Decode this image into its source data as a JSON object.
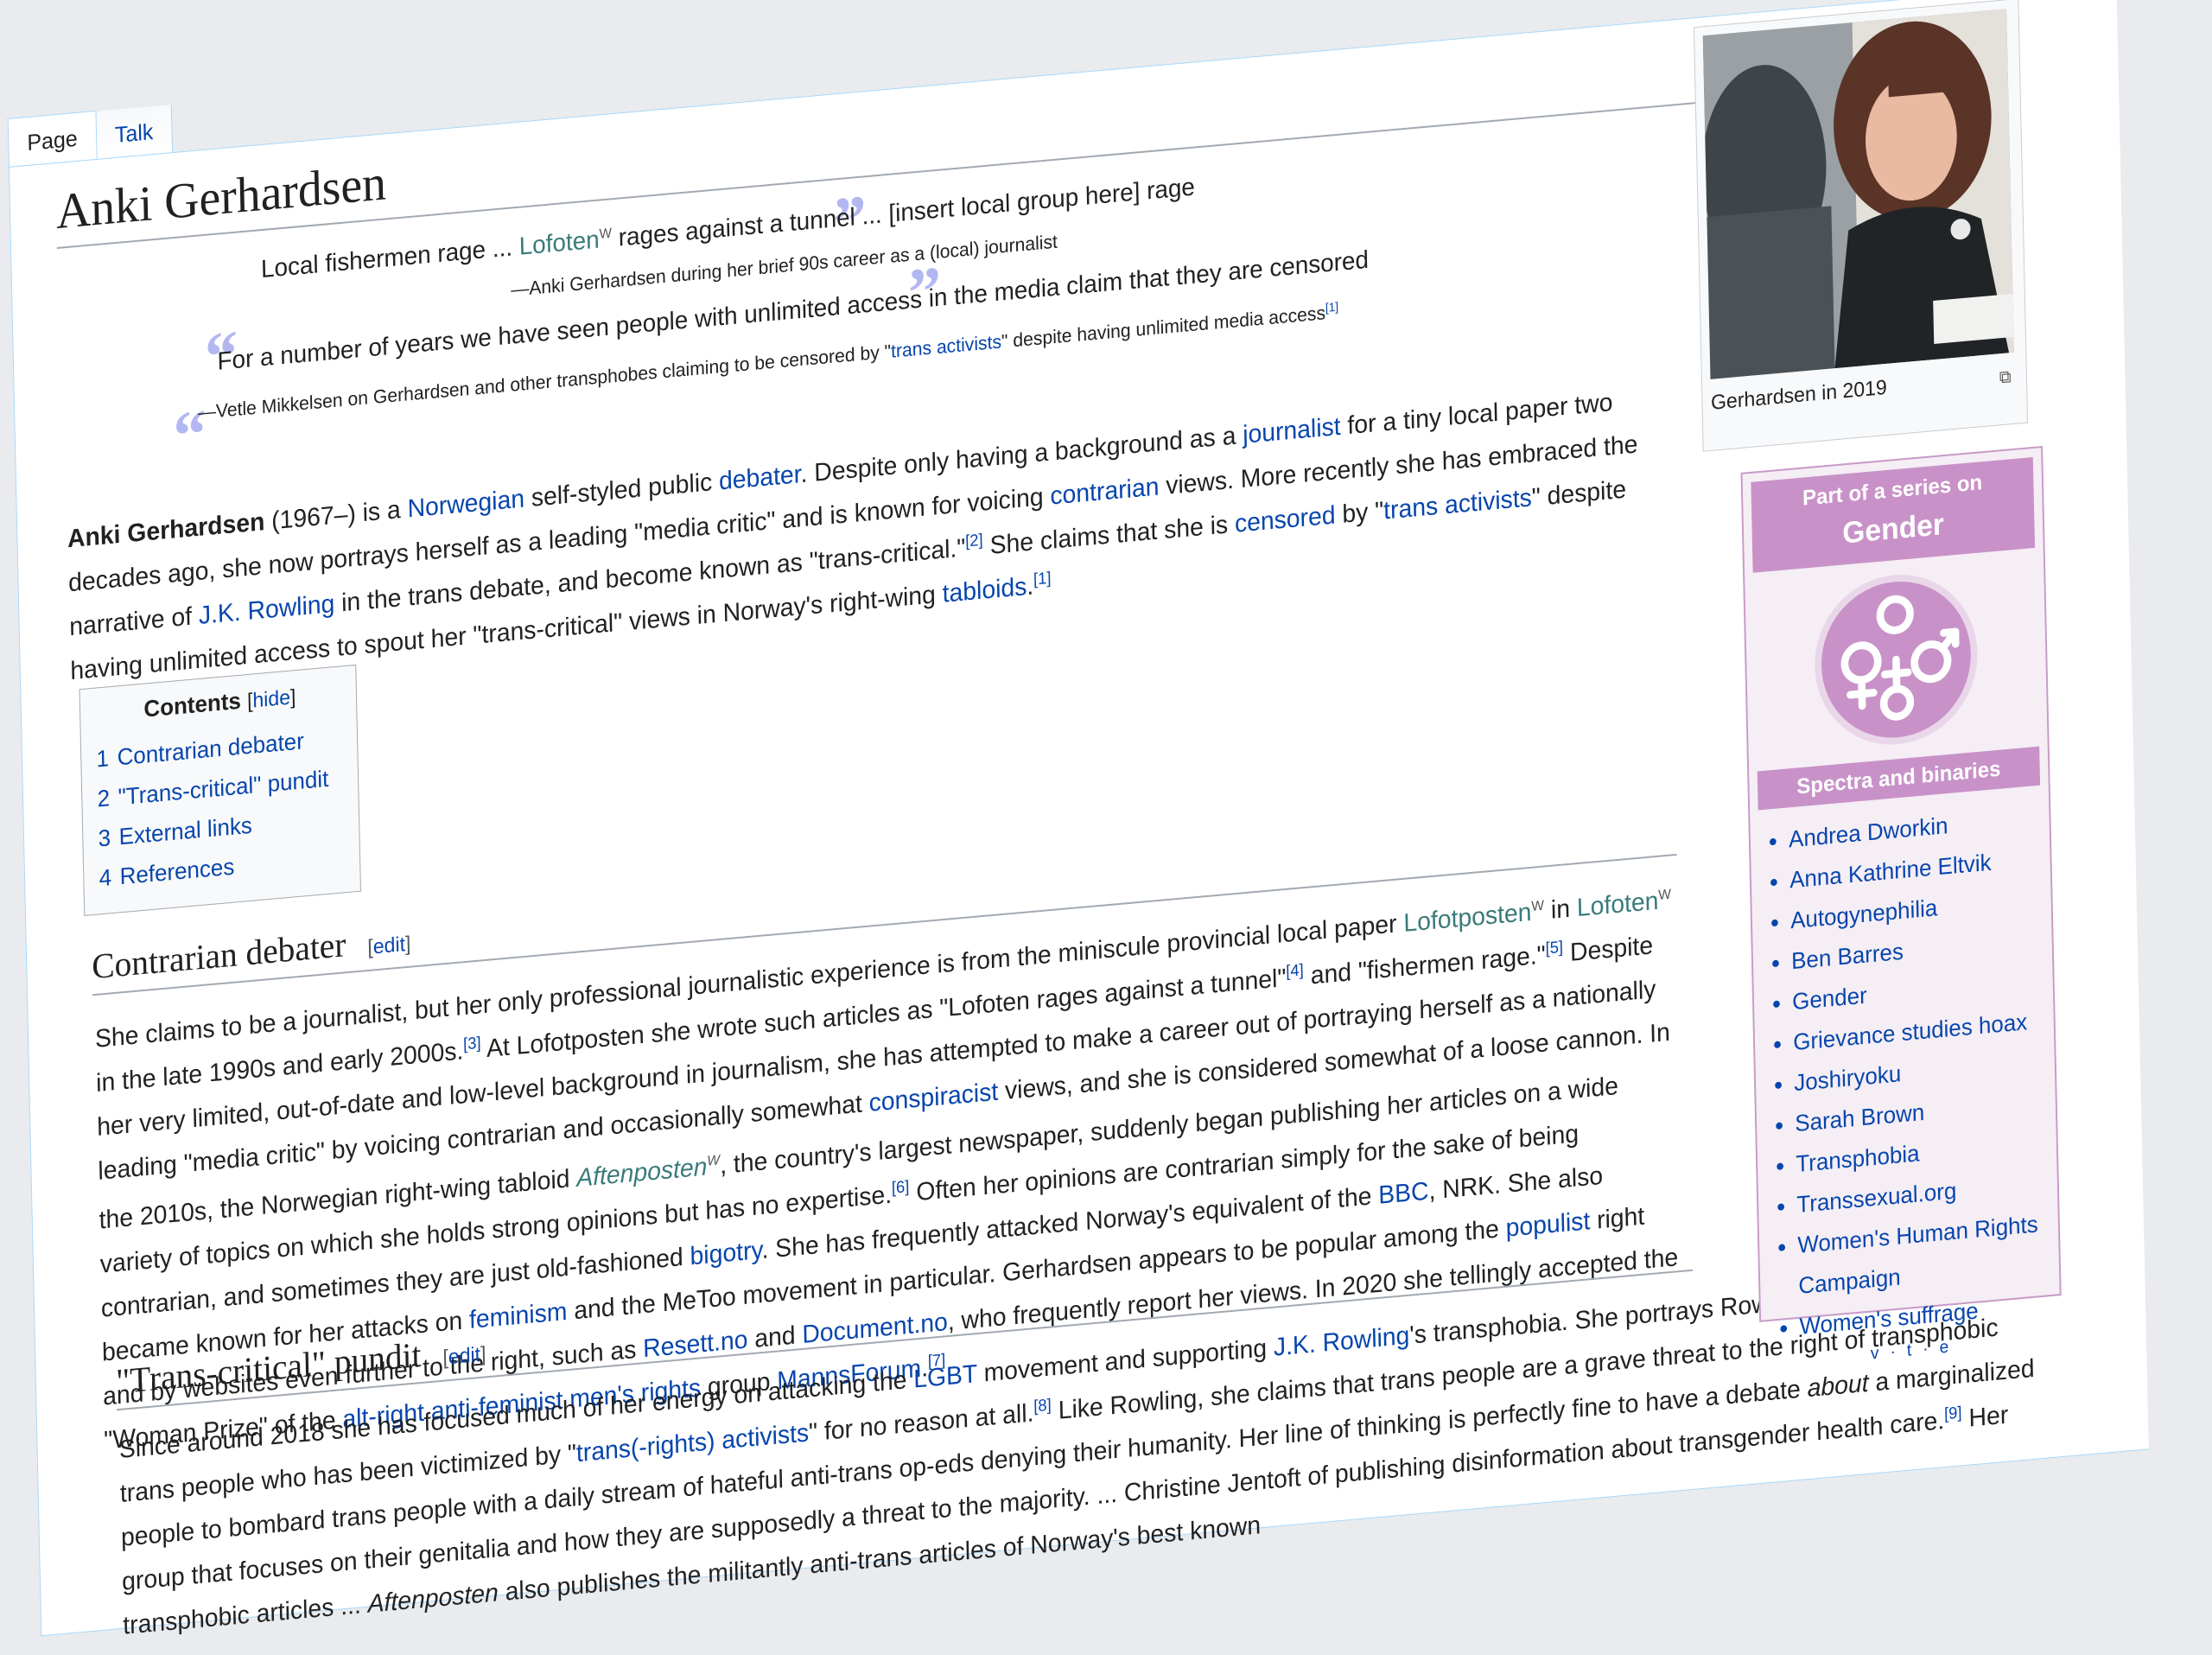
{
  "tabs": {
    "page": "Page",
    "talk": "Talk"
  },
  "title": "Anki Gerhardsen",
  "quotes": [
    {
      "before": "Local fishermen rage ... ",
      "link": "Lofoten",
      "after": " rages against a tunnel ... [insert local group here] rage",
      "attribution": "—Anki Gerhardsen during her brief 90s career as a (local) journalist"
    },
    {
      "text": "For a number of years we have seen people with unlimited access in the media claim that they are censored",
      "attr_before": "—Vetle Mikkelsen on Gerhardsen and other transphobes claiming to be censored by \"",
      "attr_link": "trans activists",
      "attr_after": "\" despite having unlimited media access",
      "attr_ref": "[1]"
    }
  ],
  "lead": {
    "name": "Anki Gerhardsen",
    "t1": " (1967–) is a ",
    "l_norwegian": "Norwegian",
    "t2": " self-styled public ",
    "l_debater": "debater",
    "t3": ". Despite only having a background as a ",
    "l_journalist": "journalist",
    "t4": " for a tiny local paper two decades ago, she now portrays herself as a leading \"media critic\" and is known for voicing ",
    "l_contrarian": "contrarian",
    "t5": " views. More recently she has embraced the narrative of ",
    "l_rowling": "J.K. Rowling",
    "t6": " in the trans debate, and become known as \"trans-critical.\"",
    "r2": "[2]",
    "t7": " She claims that she is ",
    "l_censored": "censored",
    "t8": " by \"",
    "l_transactivists": "trans activists",
    "t9": "\" despite having unlimited access to spout her \"trans-critical\" views in Norway's right-wing ",
    "l_tabloids": "tabloids",
    "t10": ".",
    "r1": "[1]"
  },
  "toc": {
    "title": "Contents",
    "hide": "hide",
    "items": [
      {
        "num": "1",
        "label": "Contrarian debater"
      },
      {
        "num": "2",
        "label": "\"Trans-critical\" pundit"
      },
      {
        "num": "3",
        "label": "External links"
      },
      {
        "num": "4",
        "label": "References"
      }
    ]
  },
  "section1": {
    "heading": "Contrarian debater",
    "edit": "edit",
    "p": {
      "a1": "She claims to be a journalist, but her only professional journalistic experience is from the miniscule provincial local paper ",
      "l_lofotposten": "Lofotposten",
      "a2": " in ",
      "l_lofoten": "Lofoten",
      "a3": " in the late 1990s and early 2000s.",
      "r3": "[3]",
      "a4": " At Lofotposten she wrote such articles as \"Lofoten rages against a tunnel\"",
      "r4": "[4]",
      "a5": " and \"fishermen rage.\"",
      "r5": "[5]",
      "a6": " Despite her very limited, out-of-date and low-level background in journalism, she has attempted to make a career out of portraying herself as a nationally leading \"media critic\" by voicing contrarian and occasionally somewhat ",
      "l_conspiracist": "conspiracist",
      "a7": " views, and she is considered somewhat of a loose cannon. In the 2010s, the Norwegian right-wing tabloid ",
      "l_aftenposten": "Aftenposten",
      "a8": ", the country's largest newspaper, suddenly began publishing her articles on a wide variety of topics on which she holds strong opinions but has no expertise.",
      "r6": "[6]",
      "a9": " Often her opinions are contrarian simply for the sake of being contrarian, and sometimes they are just old-fashioned ",
      "l_bigotry": "bigotry",
      "a10": ". She has frequently attacked Norway's equivalent of the ",
      "l_bbc": "BBC",
      "a11": ", NRK. She also became known for her attacks on ",
      "l_feminism": "feminism",
      "a12": " and the MeToo movement in particular. Gerhardsen appears to be popular among the ",
      "l_populist": "populist",
      "a13": " right and by websites even further to the right, such as ",
      "l_resett": "Resett.no",
      "a14": " and ",
      "l_document": "Document.no",
      "a15": ", who frequently report her views. In 2020 she tellingly accepted the \"Woman Prize\" of the ",
      "l_altright": "alt-right",
      "a16": " ",
      "l_antifem": "anti-feminist",
      "a17": " ",
      "l_mrm": "men's rights",
      "a18": " group ",
      "l_manns": "MannsForum",
      "a19": ".",
      "r7": "[7]"
    }
  },
  "section2": {
    "heading": "\"Trans-critical\" pundit",
    "edit": "edit",
    "p": {
      "b1": "Since around 2018 she has focused much of her energy on attacking the ",
      "l_lgbt": "LGBT",
      "b2": " movement and supporting ",
      "l_rowling": "J.K. Rowling",
      "b3": "'s transphobia. She portrays Rowling as a caring friend of trans people who has been victimized by \"",
      "l_tra": "trans(-rights) activists",
      "b4": "\" for no reason at all.",
      "r8": "[8]",
      "b5": " Like Rowling, she claims that trans people are a grave threat to the right of transphobic people to bombard trans people with a daily stream of hateful anti-trans op-eds denying their humanity. Her line of thinking is perfectly fine to have a debate ",
      "em_about": "about",
      "b6": " a marginalized group that focuses on their genitalia and how they are supposedly a threat to the majority. ... Christine Jentoft of publishing disinformation about transgender health care.",
      "r9": "[9]",
      "b7": " Her transphobic articles ... ",
      "em_aften": "Aftenposten",
      "b8": " also publishes the militantly anti-trans articles of Norway's best known"
    }
  },
  "photo": {
    "caption": "Gerhardsen in 2019"
  },
  "series": {
    "part_of": "Part of a series on",
    "topic": "Gender",
    "subheading": "Spectra and binaries",
    "items": [
      "Andrea Dworkin",
      "Anna Kathrine Eltvik",
      "Autogynephilia",
      "Ben Barres",
      "Gender",
      "Grievance studies hoax",
      "Joshiryoku",
      "Sarah Brown",
      "Transphobia",
      "Transsexual.org",
      "Women's Human Rights Campaign",
      "Women's suffrage"
    ],
    "vte": "v · t · e"
  },
  "colors": {
    "link": "#0645ad",
    "series_accent": "#c892c8",
    "quote_mark": "#b2b7f2"
  }
}
